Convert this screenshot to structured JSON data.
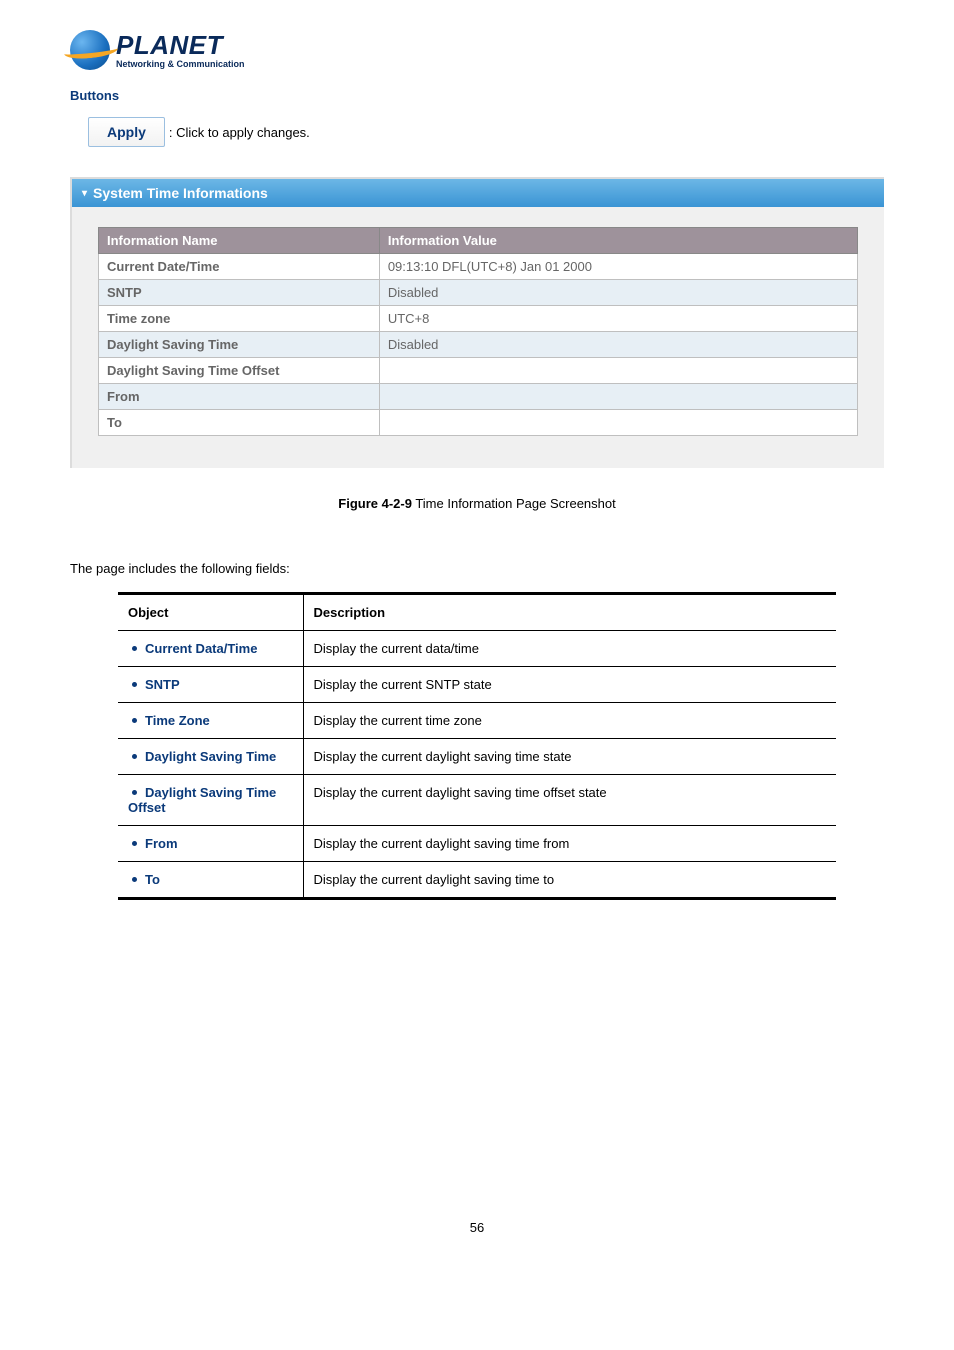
{
  "logo": {
    "brand": "PLANET",
    "tagline": "Networking & Communication"
  },
  "buttons_header": "Buttons",
  "apply": {
    "label": "Apply",
    "desc": ": Click to apply changes."
  },
  "info_panel": {
    "title": "System Time Informations",
    "col_name": "Information Name",
    "col_value": "Information Value",
    "rows": [
      {
        "name": "Current Date/Time",
        "value": "09:13:10 DFL(UTC+8) Jan 01 2000"
      },
      {
        "name": "SNTP",
        "value": "Disabled"
      },
      {
        "name": "Time zone",
        "value": "UTC+8"
      },
      {
        "name": "Daylight Saving Time",
        "value": "Disabled"
      },
      {
        "name": "Daylight Saving Time Offset",
        "value": ""
      },
      {
        "name": "From",
        "value": ""
      },
      {
        "name": "To",
        "value": ""
      }
    ]
  },
  "figure": {
    "label": "Figure 4-2-9",
    "text": " Time Information Page Screenshot"
  },
  "intro": "The page includes the following fields:",
  "desc_table": {
    "col_object": "Object",
    "col_desc": "Description",
    "rows": [
      {
        "object": "Current Data/Time",
        "desc": "Display the current data/time"
      },
      {
        "object": "SNTP",
        "desc": "Display the current SNTP state"
      },
      {
        "object": "Time Zone",
        "desc": "Display the current time zone"
      },
      {
        "object": "Daylight Saving Time",
        "desc": "Display the current daylight saving time state"
      },
      {
        "object": "Daylight Saving Time Offset",
        "desc": "Display the current daylight saving time offset state"
      },
      {
        "object": "From",
        "desc": "Display the current daylight saving time from"
      },
      {
        "object": "To",
        "desc": "Display the current daylight saving time to"
      }
    ]
  },
  "page_number": "56"
}
